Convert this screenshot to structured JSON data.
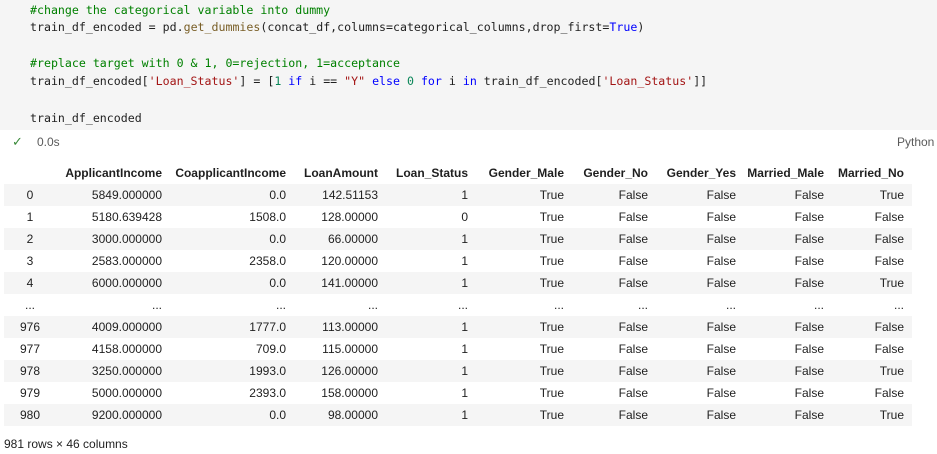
{
  "code": {
    "comment1": "#change the categorical variable into dummy",
    "line2": {
      "var": "train_df_encoded",
      "eq": " = ",
      "mod": "pd",
      "dot": ".",
      "fn": "get_dummies",
      "args": "(concat_df,columns=categorical_columns,drop_first=",
      "kwTrue": "True",
      "close": ")"
    },
    "comment2": "#replace target with 0 & 1, 0=rejection, 1=acceptance",
    "line4": {
      "lhs": "train_df_encoded[",
      "key": "'Loan_Status'",
      "mid": "] = [",
      "one": "1",
      "if": " if ",
      "cond": "i == ",
      "y": "\"Y\"",
      "else": " else ",
      "zero": "0",
      "for": " for ",
      "i": "i",
      "in": " in ",
      "rhs": "train_df_encoded[",
      "key2": "'Loan_Status'",
      "end": "]]"
    },
    "line6": "train_df_encoded"
  },
  "execution": {
    "check": "✓",
    "time": "0.0s",
    "kernel": "Python"
  },
  "table": {
    "columns": [
      "",
      "ApplicantIncome",
      "CoapplicantIncome",
      "LoanAmount",
      "Loan_Status",
      "Gender_Male",
      "Gender_No",
      "Gender_Yes",
      "Married_Male",
      "Married_No"
    ],
    "rows": [
      [
        "0",
        "5849.000000",
        "0.0",
        "142.51153",
        "1",
        "True",
        "False",
        "False",
        "False",
        "True"
      ],
      [
        "1",
        "5180.639428",
        "1508.0",
        "128.00000",
        "0",
        "True",
        "False",
        "False",
        "False",
        "False"
      ],
      [
        "2",
        "3000.000000",
        "0.0",
        "66.00000",
        "1",
        "True",
        "False",
        "False",
        "False",
        "False"
      ],
      [
        "3",
        "2583.000000",
        "2358.0",
        "120.00000",
        "1",
        "True",
        "False",
        "False",
        "False",
        "False"
      ],
      [
        "4",
        "6000.000000",
        "0.0",
        "141.00000",
        "1",
        "True",
        "False",
        "False",
        "False",
        "True"
      ],
      [
        "...",
        "...",
        "...",
        "...",
        "...",
        "...",
        "...",
        "...",
        "...",
        "..."
      ],
      [
        "976",
        "4009.000000",
        "1777.0",
        "113.00000",
        "1",
        "True",
        "False",
        "False",
        "False",
        "False"
      ],
      [
        "977",
        "4158.000000",
        "709.0",
        "115.00000",
        "1",
        "True",
        "False",
        "False",
        "False",
        "False"
      ],
      [
        "978",
        "3250.000000",
        "1993.0",
        "126.00000",
        "1",
        "True",
        "False",
        "False",
        "False",
        "True"
      ],
      [
        "979",
        "5000.000000",
        "2393.0",
        "158.00000",
        "1",
        "True",
        "False",
        "False",
        "False",
        "False"
      ],
      [
        "980",
        "9200.000000",
        "0.0",
        "98.00000",
        "1",
        "True",
        "False",
        "False",
        "False",
        "True"
      ]
    ]
  },
  "footer": "981 rows × 46 columns"
}
